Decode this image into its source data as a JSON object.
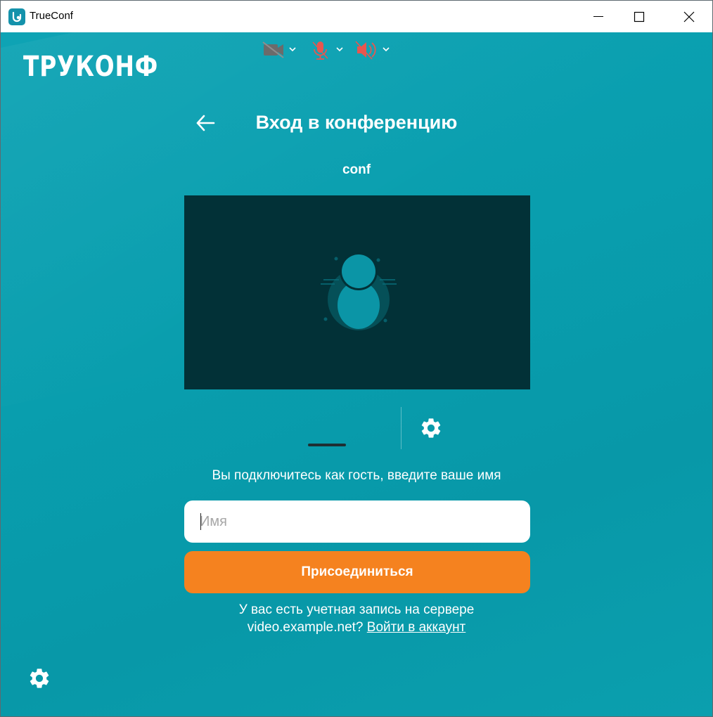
{
  "window": {
    "title": "TrueConf",
    "controls": [
      "minimize",
      "maximize",
      "close"
    ]
  },
  "brand": {
    "logo_text": "ТРУКОНФ"
  },
  "header": {
    "back_icon": "arrow-left-icon",
    "title": "Вход в конференцию"
  },
  "conference": {
    "name": "conf"
  },
  "media_controls": {
    "camera": {
      "icon": "camera-off-icon",
      "state": "off"
    },
    "microphone": {
      "icon": "mic-off-icon",
      "state": "off"
    },
    "speaker": {
      "icon": "speaker-off-icon",
      "state": "off"
    },
    "settings_icon": "gear-icon"
  },
  "guest": {
    "hint": "Вы подключитесь как гость, введите ваше имя",
    "name_placeholder": "Имя",
    "name_value": ""
  },
  "join_button": {
    "label": "Присоединиться"
  },
  "account": {
    "line1": "У вас есть учетная запись на сервере",
    "server": "video.example.net?",
    "login_link": "Войти в аккаунт"
  },
  "colors": {
    "background": "#0a9fae",
    "preview_bg": "#023137",
    "accent_orange": "#f5821f",
    "muted_red": "#e8564f"
  }
}
